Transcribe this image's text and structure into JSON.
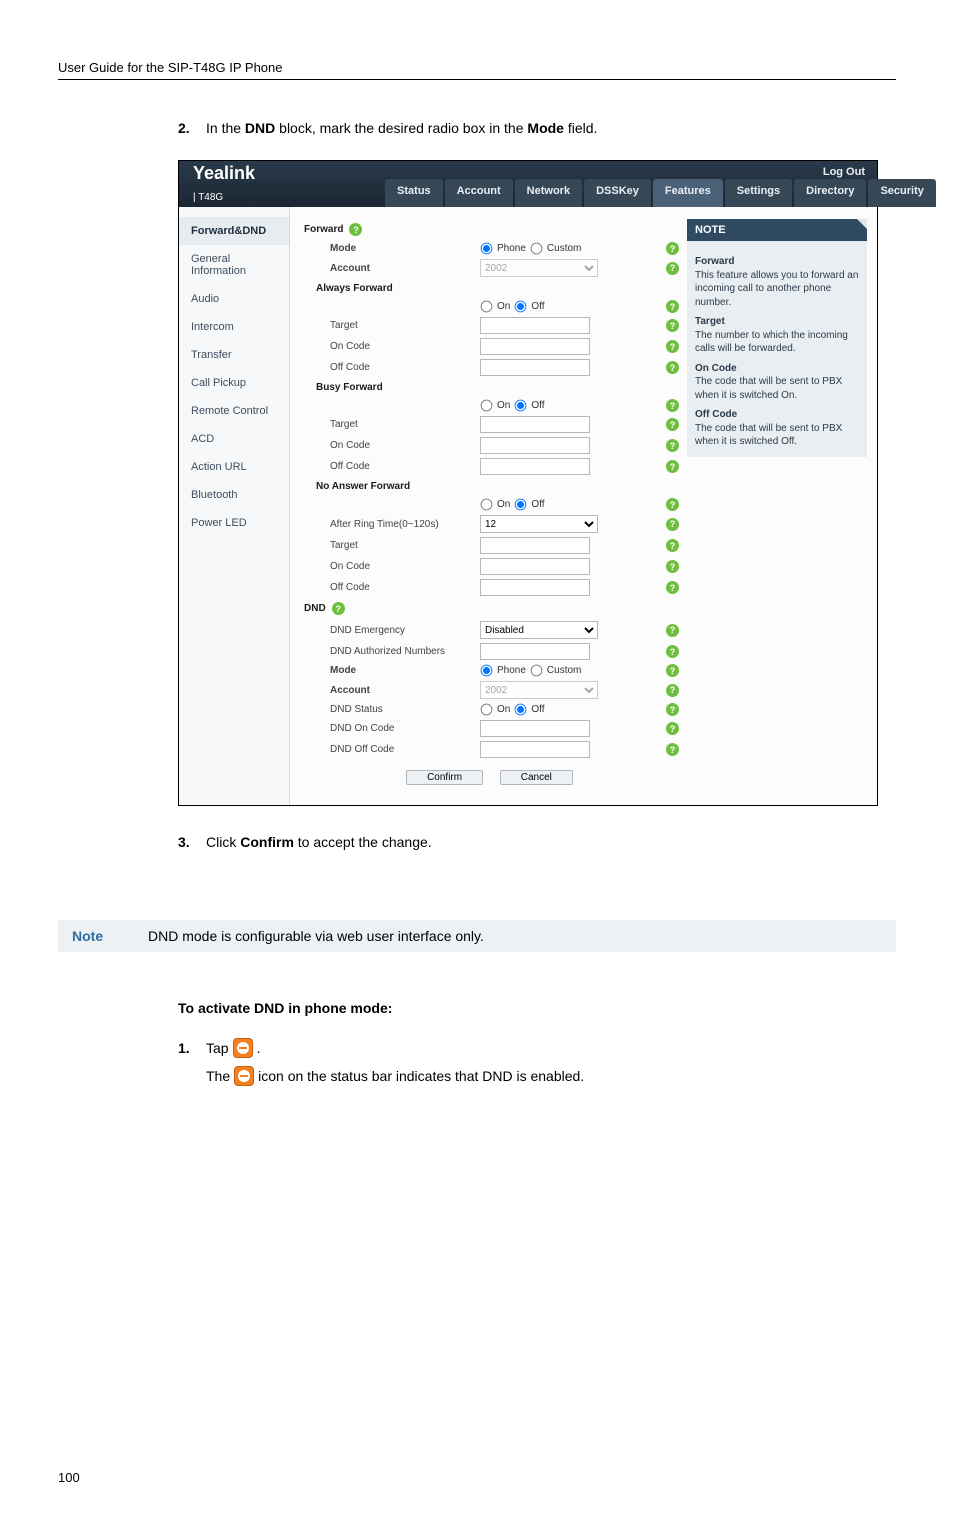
{
  "doc": {
    "header": "User Guide for the SIP-T48G IP Phone",
    "page_number": "100"
  },
  "steps": {
    "s2_num": "2.",
    "s2_pre": "In the ",
    "s2_b1": "DND",
    "s2_mid": " block, mark the desired radio box in the ",
    "s2_b2": "Mode",
    "s2_post": " field.",
    "s3_num": "3.",
    "s3_pre": "Click ",
    "s3_b": "Confirm",
    "s3_post": " to accept the change."
  },
  "note_strip": {
    "label": "Note",
    "text": "DND mode is configurable via web user interface only."
  },
  "activate": {
    "title": "To activate DND in phone mode:",
    "s1_num": "1.",
    "s1_a": "Tap",
    "s1_dot": ".",
    "s1_b": "The",
    "s1_c": "icon on the status bar indicates that DND is enabled."
  },
  "ss": {
    "logo_main": "Yealink",
    "logo_sub": " | T48G",
    "logout": "Log Out",
    "tabs": [
      "Status",
      "Account",
      "Network",
      "DSSKey",
      "Features",
      "Settings",
      "Directory",
      "Security"
    ],
    "active_tab": 4,
    "sidebar": [
      "Forward&DND",
      "General Information",
      "Audio",
      "Intercom",
      "Transfer",
      "Call Pickup",
      "Remote Control",
      "ACD",
      "Action URL",
      "Bluetooth",
      "Power LED"
    ],
    "active_side": 0,
    "forward": {
      "head": "Forward",
      "mode_lbl": "Mode",
      "mode_a": "Phone",
      "mode_b": "Custom",
      "account_lbl": "Account",
      "account_val": "2002",
      "always_head": "Always Forward",
      "on": "On",
      "off": "Off",
      "target_lbl": "Target",
      "oncode_lbl": "On Code",
      "offcode_lbl": "Off Code",
      "busy_head": "Busy Forward",
      "noans_head": "No Answer Forward",
      "after_ring_lbl": "After Ring Time(0~120s)",
      "after_ring_val": "12"
    },
    "dnd": {
      "head": "DND",
      "emergency_lbl": "DND Emergency",
      "emergency_val": "Disabled",
      "auth_lbl": "DND Authorized Numbers",
      "mode_lbl": "Mode",
      "mode_a": "Phone",
      "mode_b": "Custom",
      "account_lbl": "Account",
      "account_val": "2002",
      "status_lbl": "DND Status",
      "on": "On",
      "off": "Off",
      "oncode_lbl": "DND On Code",
      "offcode_lbl": "DND Off Code"
    },
    "buttons": {
      "confirm": "Confirm",
      "cancel": "Cancel"
    },
    "note_box": {
      "header": "NOTE",
      "forward_t": "Forward",
      "forward_b": "This feature allows you to forward an incoming call to another phone number.",
      "target_t": "Target",
      "target_b": "The number to which the incoming calls will be forwarded.",
      "oncode_t": "On Code",
      "oncode_b": "The code that will be sent to PBX when it is switched On.",
      "offcode_t": "Off Code",
      "offcode_b": "The code that will be sent to PBX when it is switched Off."
    }
  }
}
